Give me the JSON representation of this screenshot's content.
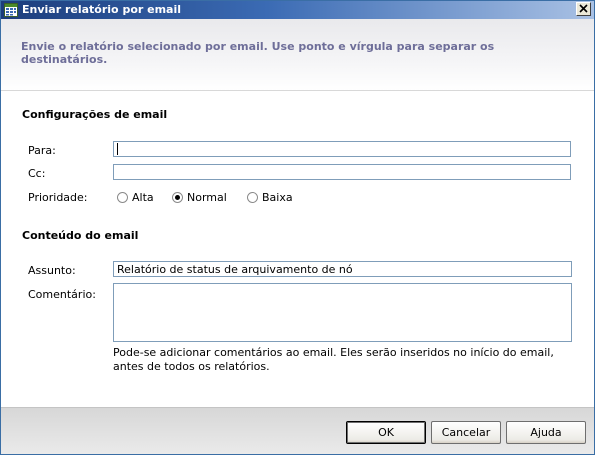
{
  "window": {
    "title": "Enviar relatório por email"
  },
  "header": {
    "description": "Envie o relatório selecionado por email. Use ponto e vírgula para separar os destinatários."
  },
  "email_settings": {
    "section_title": "Configurações de email",
    "to_label": "Para:",
    "to_value": "",
    "cc_label": "Cc:",
    "cc_value": "",
    "priority_label": "Prioridade:",
    "priority_options": [
      "Alta",
      "Normal",
      "Baixa"
    ],
    "priority_selected": "Normal"
  },
  "email_content": {
    "section_title": "Conteúdo do email",
    "subject_label": "Assunto:",
    "subject_value": "Relatório de status de arquivamento de nó",
    "comment_label": "Comentário:",
    "comment_value": "",
    "comment_hint": "Pode-se adicionar comentários ao email. Eles serão inseridos no início do email, antes de todos os relatórios."
  },
  "buttons": {
    "ok": "OK",
    "cancel": "Cancelar",
    "help": "Ajuda"
  },
  "icons": {
    "title_icon": "report-icon",
    "close_icon": "close-icon"
  }
}
